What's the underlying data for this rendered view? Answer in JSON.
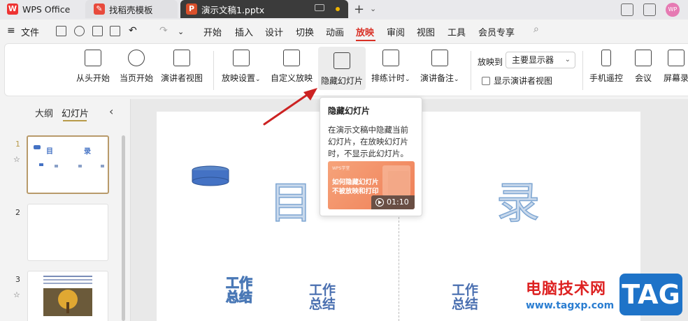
{
  "titlebar": {
    "tabs": [
      {
        "label": "WPS Office",
        "icon": "wps-logo-icon"
      },
      {
        "label": "找稻壳模板",
        "icon": "daoke-logo-icon"
      },
      {
        "label": "演示文稿1.pptx",
        "icon": "presentation-file-icon"
      }
    ],
    "avatar_text": "WP"
  },
  "menu": {
    "file": "文件",
    "items": [
      "开始",
      "插入",
      "设计",
      "切换",
      "动画",
      "放映",
      "审阅",
      "视图",
      "工具",
      "会员专享"
    ],
    "active": "放映"
  },
  "ribbon": {
    "buttons": [
      {
        "label": "从头开始",
        "icon": "play-from-start-icon"
      },
      {
        "label": "当页开始",
        "icon": "play-current-icon"
      },
      {
        "label": "演讲者视图",
        "icon": "presenter-view-icon"
      },
      {
        "label": "放映设置",
        "icon": "slideshow-settings-icon"
      },
      {
        "label": "自定义放映",
        "icon": "custom-show-icon"
      },
      {
        "label": "隐藏幻灯片",
        "icon": "hide-slide-icon"
      },
      {
        "label": "排练计时",
        "icon": "rehearse-timing-icon"
      },
      {
        "label": "演讲备注",
        "icon": "speaker-notes-icon"
      },
      {
        "label": "手机遥控",
        "icon": "phone-remote-icon"
      },
      {
        "label": "会议",
        "icon": "meeting-icon"
      },
      {
        "label": "屏幕录",
        "icon": "screen-record-icon"
      }
    ],
    "display_to_label": "放映到",
    "display_select_value": "主要显示器",
    "presenter_checkbox_label": "显示演讲者视图"
  },
  "leftpanel": {
    "tab_outline": "大纲",
    "tab_slides": "幻灯片",
    "slide_numbers": [
      "1",
      "2",
      "3"
    ]
  },
  "slide": {
    "title_left": "目",
    "title_right": "录",
    "items": [
      "工作总结",
      "工作总结",
      "工作总结"
    ]
  },
  "tooltip": {
    "title": "隐藏幻灯片",
    "description": "在演示文稿中隐藏当前幻灯片，在放映幻灯片时，不显示此幻灯片。",
    "video_caption_line1": "如何隐藏幻灯片",
    "video_caption_line2": "不被放映和打印",
    "video_duration": "01:10"
  },
  "watermark": {
    "site_name": "电脑技术网",
    "url": "www.tagxp.com",
    "badge": "TAG"
  },
  "colors": {
    "accent_red": "#d93025",
    "arrow_red": "#cc2222",
    "slide_shape_blue": "#4472c4",
    "watermark_blue": "#1e73c8"
  }
}
